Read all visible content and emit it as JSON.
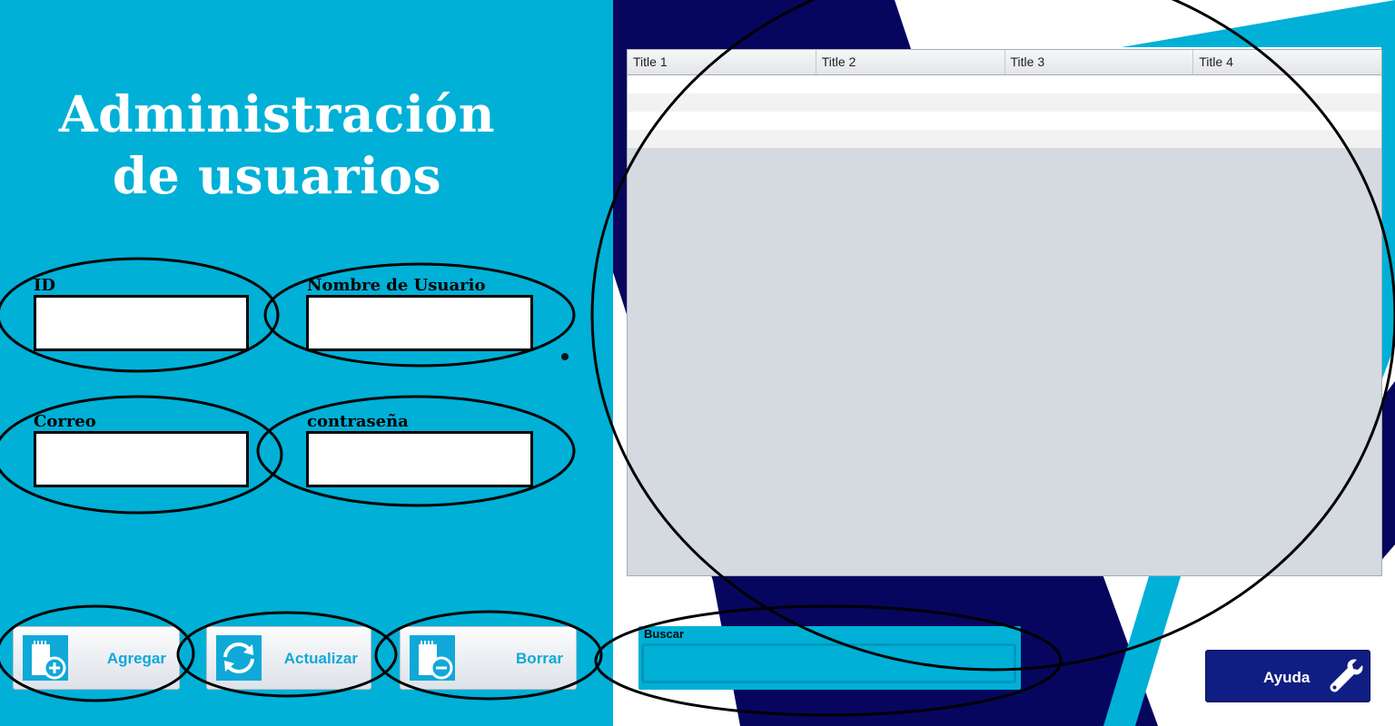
{
  "title": {
    "line1": "Administración",
    "line2": "de usuarios"
  },
  "form": {
    "id_label": "ID",
    "username_label": "Nombre de Usuario",
    "email_label": "Correo",
    "password_label": "contraseña",
    "id_value": "",
    "username_value": "",
    "email_value": "",
    "password_value": ""
  },
  "buttons": {
    "add": "Agregar",
    "update": "Actualizar",
    "delete": "Borrar"
  },
  "table": {
    "columns": [
      "Title 1",
      "Title 2",
      "Title 3",
      "Title 4"
    ],
    "rows": [
      [
        "",
        "",
        "",
        ""
      ],
      [
        "",
        "",
        "",
        ""
      ],
      [
        "",
        "",
        "",
        ""
      ],
      [
        "",
        "",
        "",
        ""
      ]
    ]
  },
  "search": {
    "label": "Buscar",
    "value": ""
  },
  "help": {
    "label": "Ayuda",
    "icon": "wrench-icon"
  },
  "colors": {
    "panel": "#00b0d7",
    "navy": "#0a0c63",
    "button_text": "#10a8d8",
    "help_button": "#101d82"
  }
}
